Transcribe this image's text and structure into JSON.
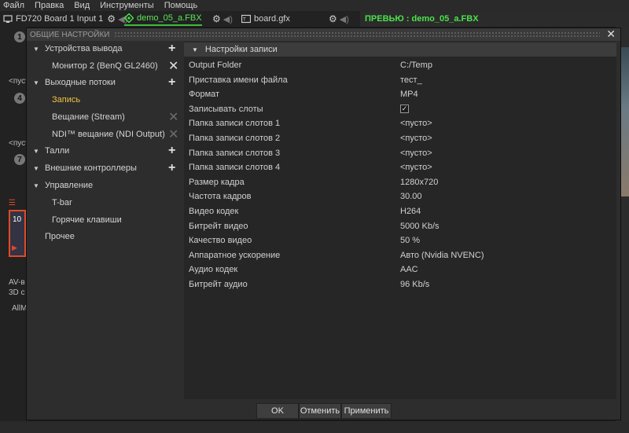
{
  "menu": [
    "Файл",
    "Правка",
    "Вид",
    "Инструменты",
    "Помощь"
  ],
  "tabs": {
    "board_input": "FD720 Board 1 Input 1",
    "scene": "demo_05_a.FBX",
    "gfx": "board.gfx",
    "preview": "ПРЕВЬЮ : demo_05_a.FBX"
  },
  "background": {
    "nums": [
      "1",
      "4",
      "7",
      "10"
    ],
    "empty1": "<пусто>",
    "empty2": "<пусто>",
    "av": "AV-в",
    "cu": "3D c",
    "all": "AllM"
  },
  "dialog": {
    "title": "ОБЩИЕ НАСТРОЙКИ",
    "tree": [
      {
        "label": "Устройства вывода",
        "level": 0,
        "expanded": true,
        "action": "add"
      },
      {
        "label": "Монитор 2 (BenQ GL2460)",
        "level": 1,
        "action": "remove"
      },
      {
        "label": "Выходные потоки",
        "level": 0,
        "expanded": true,
        "action": "add"
      },
      {
        "label": "Запись",
        "level": 1,
        "selected": true
      },
      {
        "label": "Вещание (Stream)",
        "level": 1,
        "action": "remove-disabled"
      },
      {
        "label": "NDI™ вещание (NDI Output)",
        "level": 1,
        "action": "remove-disabled"
      },
      {
        "label": "Талли",
        "level": 0,
        "expanded": true,
        "action": "add"
      },
      {
        "label": "Внешние контроллеры",
        "level": 0,
        "expanded": true,
        "action": "add"
      },
      {
        "label": "Управление",
        "level": 0,
        "expanded": true
      },
      {
        "label": "T-bar",
        "level": 1
      },
      {
        "label": "Горячие клавиши",
        "level": 1
      },
      {
        "label": "Прочее",
        "level": 0
      }
    ],
    "section_title": "Настройки записи",
    "settings": [
      {
        "key": "Output Folder",
        "value": "C:/Temp"
      },
      {
        "key": "Приставка имени файла",
        "value": "тест_"
      },
      {
        "key": "Формат",
        "value": "MP4"
      },
      {
        "key": "Записывать слоты",
        "value": "",
        "checkbox": true,
        "checked": true
      },
      {
        "key": "Папка записи слотов 1",
        "value": "<пусто>"
      },
      {
        "key": "Папка записи слотов 2",
        "value": "<пусто>"
      },
      {
        "key": "Папка записи слотов 3",
        "value": "<пусто>"
      },
      {
        "key": "Папка записи слотов 4",
        "value": "<пусто>"
      },
      {
        "key": "Размер кадра",
        "value": "1280x720"
      },
      {
        "key": "Частота кадров",
        "value": "30.00"
      },
      {
        "key": "Видео кодек",
        "value": "H264"
      },
      {
        "key": "Битрейт видео",
        "value": "5000 Kb/s"
      },
      {
        "key": "Качество видео",
        "value": "50 %"
      },
      {
        "key": "Аппаратное ускорение",
        "value": "Авто (Nvidia NVENC)"
      },
      {
        "key": "Аудио кодек",
        "value": "AAC"
      },
      {
        "key": "Битрейт аудио",
        "value": "96 Kb/s"
      }
    ],
    "buttons": {
      "ok": "OK",
      "cancel": "Отменить",
      "apply": "Применить"
    }
  },
  "colors": {
    "accent_green": "#4be24b",
    "selected_yellow": "#f5c242",
    "preview_red": "#e04a2a"
  }
}
